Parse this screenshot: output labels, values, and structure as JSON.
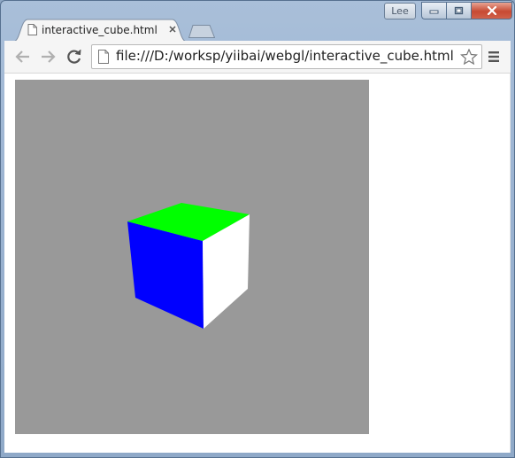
{
  "window": {
    "user_badge": "Lee"
  },
  "tab": {
    "title": "interactive_cube.html"
  },
  "omnibox": {
    "url": "file:///D:/worksp/yiibai/webgl/interactive_cube.html"
  },
  "canvas": {
    "background": "#999999",
    "cube_faces": {
      "top": "#00ff00",
      "front": "#0000ff",
      "side": "#ffffff"
    }
  },
  "icons": {
    "back": "arrow-left-icon",
    "forward": "arrow-right-icon",
    "reload": "reload-icon",
    "page": "page-icon",
    "star": "star-icon",
    "menu": "hamburger-menu-icon"
  }
}
